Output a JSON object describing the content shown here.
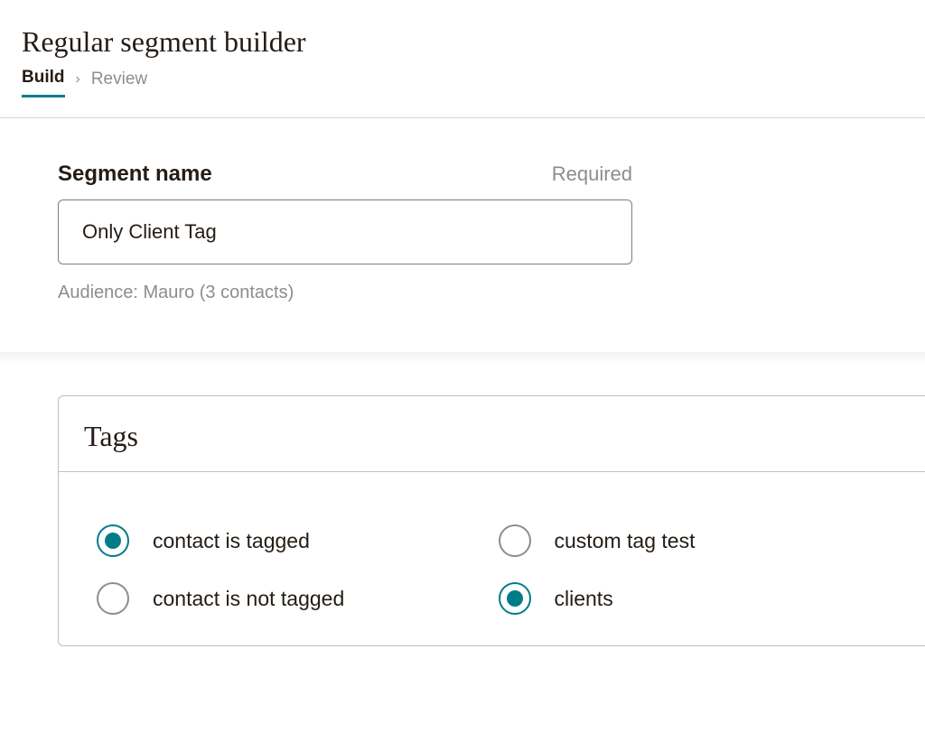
{
  "header": {
    "title": "Regular segment builder",
    "breadcrumb": {
      "active": "Build",
      "next": "Review"
    }
  },
  "segment": {
    "label": "Segment name",
    "required_label": "Required",
    "value": "Only Client Tag",
    "audience_info": "Audience: Mauro (3 contacts)"
  },
  "tags_panel": {
    "title": "Tags",
    "condition_options": [
      {
        "label": "contact is tagged",
        "checked": true
      },
      {
        "label": "contact is not tagged",
        "checked": false
      }
    ],
    "tag_options": [
      {
        "label": "custom tag test",
        "checked": false
      },
      {
        "label": "clients",
        "checked": true
      }
    ]
  }
}
